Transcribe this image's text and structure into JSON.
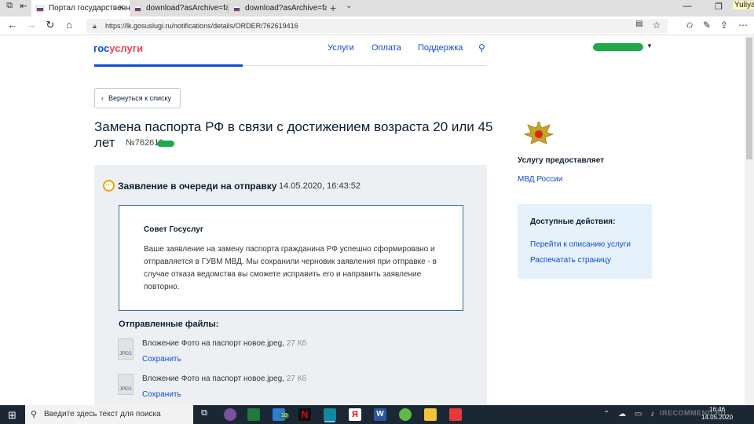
{
  "browser": {
    "tabs": [
      {
        "title": "Портал государственн",
        "active": true
      },
      {
        "title": "download?asArchive=false",
        "active": false
      },
      {
        "title": "download?asArchive=false",
        "active": false
      }
    ],
    "username": "Yuliya",
    "url": "https://lk.gosuslugi.ru/notifications/details/ORDER/762619416"
  },
  "header": {
    "logo_part1": "гос",
    "logo_part2": "услуги",
    "nav": [
      "Услуги",
      "Оплата",
      "Поддержка"
    ]
  },
  "main": {
    "back_label": "Вернуться к списку",
    "title": "Замена паспорта РФ в связи с достижением возраста 20 или 45 лет",
    "order_number": "№762619",
    "status": {
      "text": "Заявление в очереди на отправку",
      "datetime": "14.05.2020, 16:43:52"
    },
    "advice": {
      "title": "Совет Госуслуг",
      "body": "Ваше заявление на замену паспорта гражданина РФ успешно сформировано и отправляется в ГУВМ МВД. Мы сохранили черновик заявления при отправке - в случае отказа ведомства вы сможете исправить его и направить заявление повторно."
    },
    "files_title": "Отправленные файлы:",
    "files": [
      {
        "name": "Вложение Фото на паспорт новое.jpeg",
        "size": "27 Кб",
        "type": "JPEG",
        "action": "Сохранить"
      },
      {
        "name": "Вложение Фото на паспорт новое.jpeg",
        "size": "27 Кб",
        "type": "JPEG",
        "action": "Сохранить"
      }
    ]
  },
  "sidebar": {
    "provider_label": "Услугу предоставляет",
    "provider_name": "МВД России",
    "actions_title": "Доступные действия:",
    "actions": [
      "Перейти к описанию услуги",
      "Распечатать страницу"
    ]
  },
  "taskbar": {
    "search_placeholder": "Введите здесь текст для поиска",
    "badge": "10",
    "time": "16:46",
    "date": "14.05.2020",
    "watermark": "IRECOMMEND.RU",
    "apps": [
      "task-view",
      "viber",
      "store",
      "mail",
      "netflix",
      "edge",
      "yandex",
      "word",
      "utorrent",
      "explorer",
      "app"
    ]
  },
  "colors": {
    "brand_blue": "#0d4cd3",
    "brand_red": "#ee3f58",
    "status_orange": "#e8a20a",
    "card_bg": "#edf0f3",
    "actions_bg": "#e6f2fb"
  }
}
